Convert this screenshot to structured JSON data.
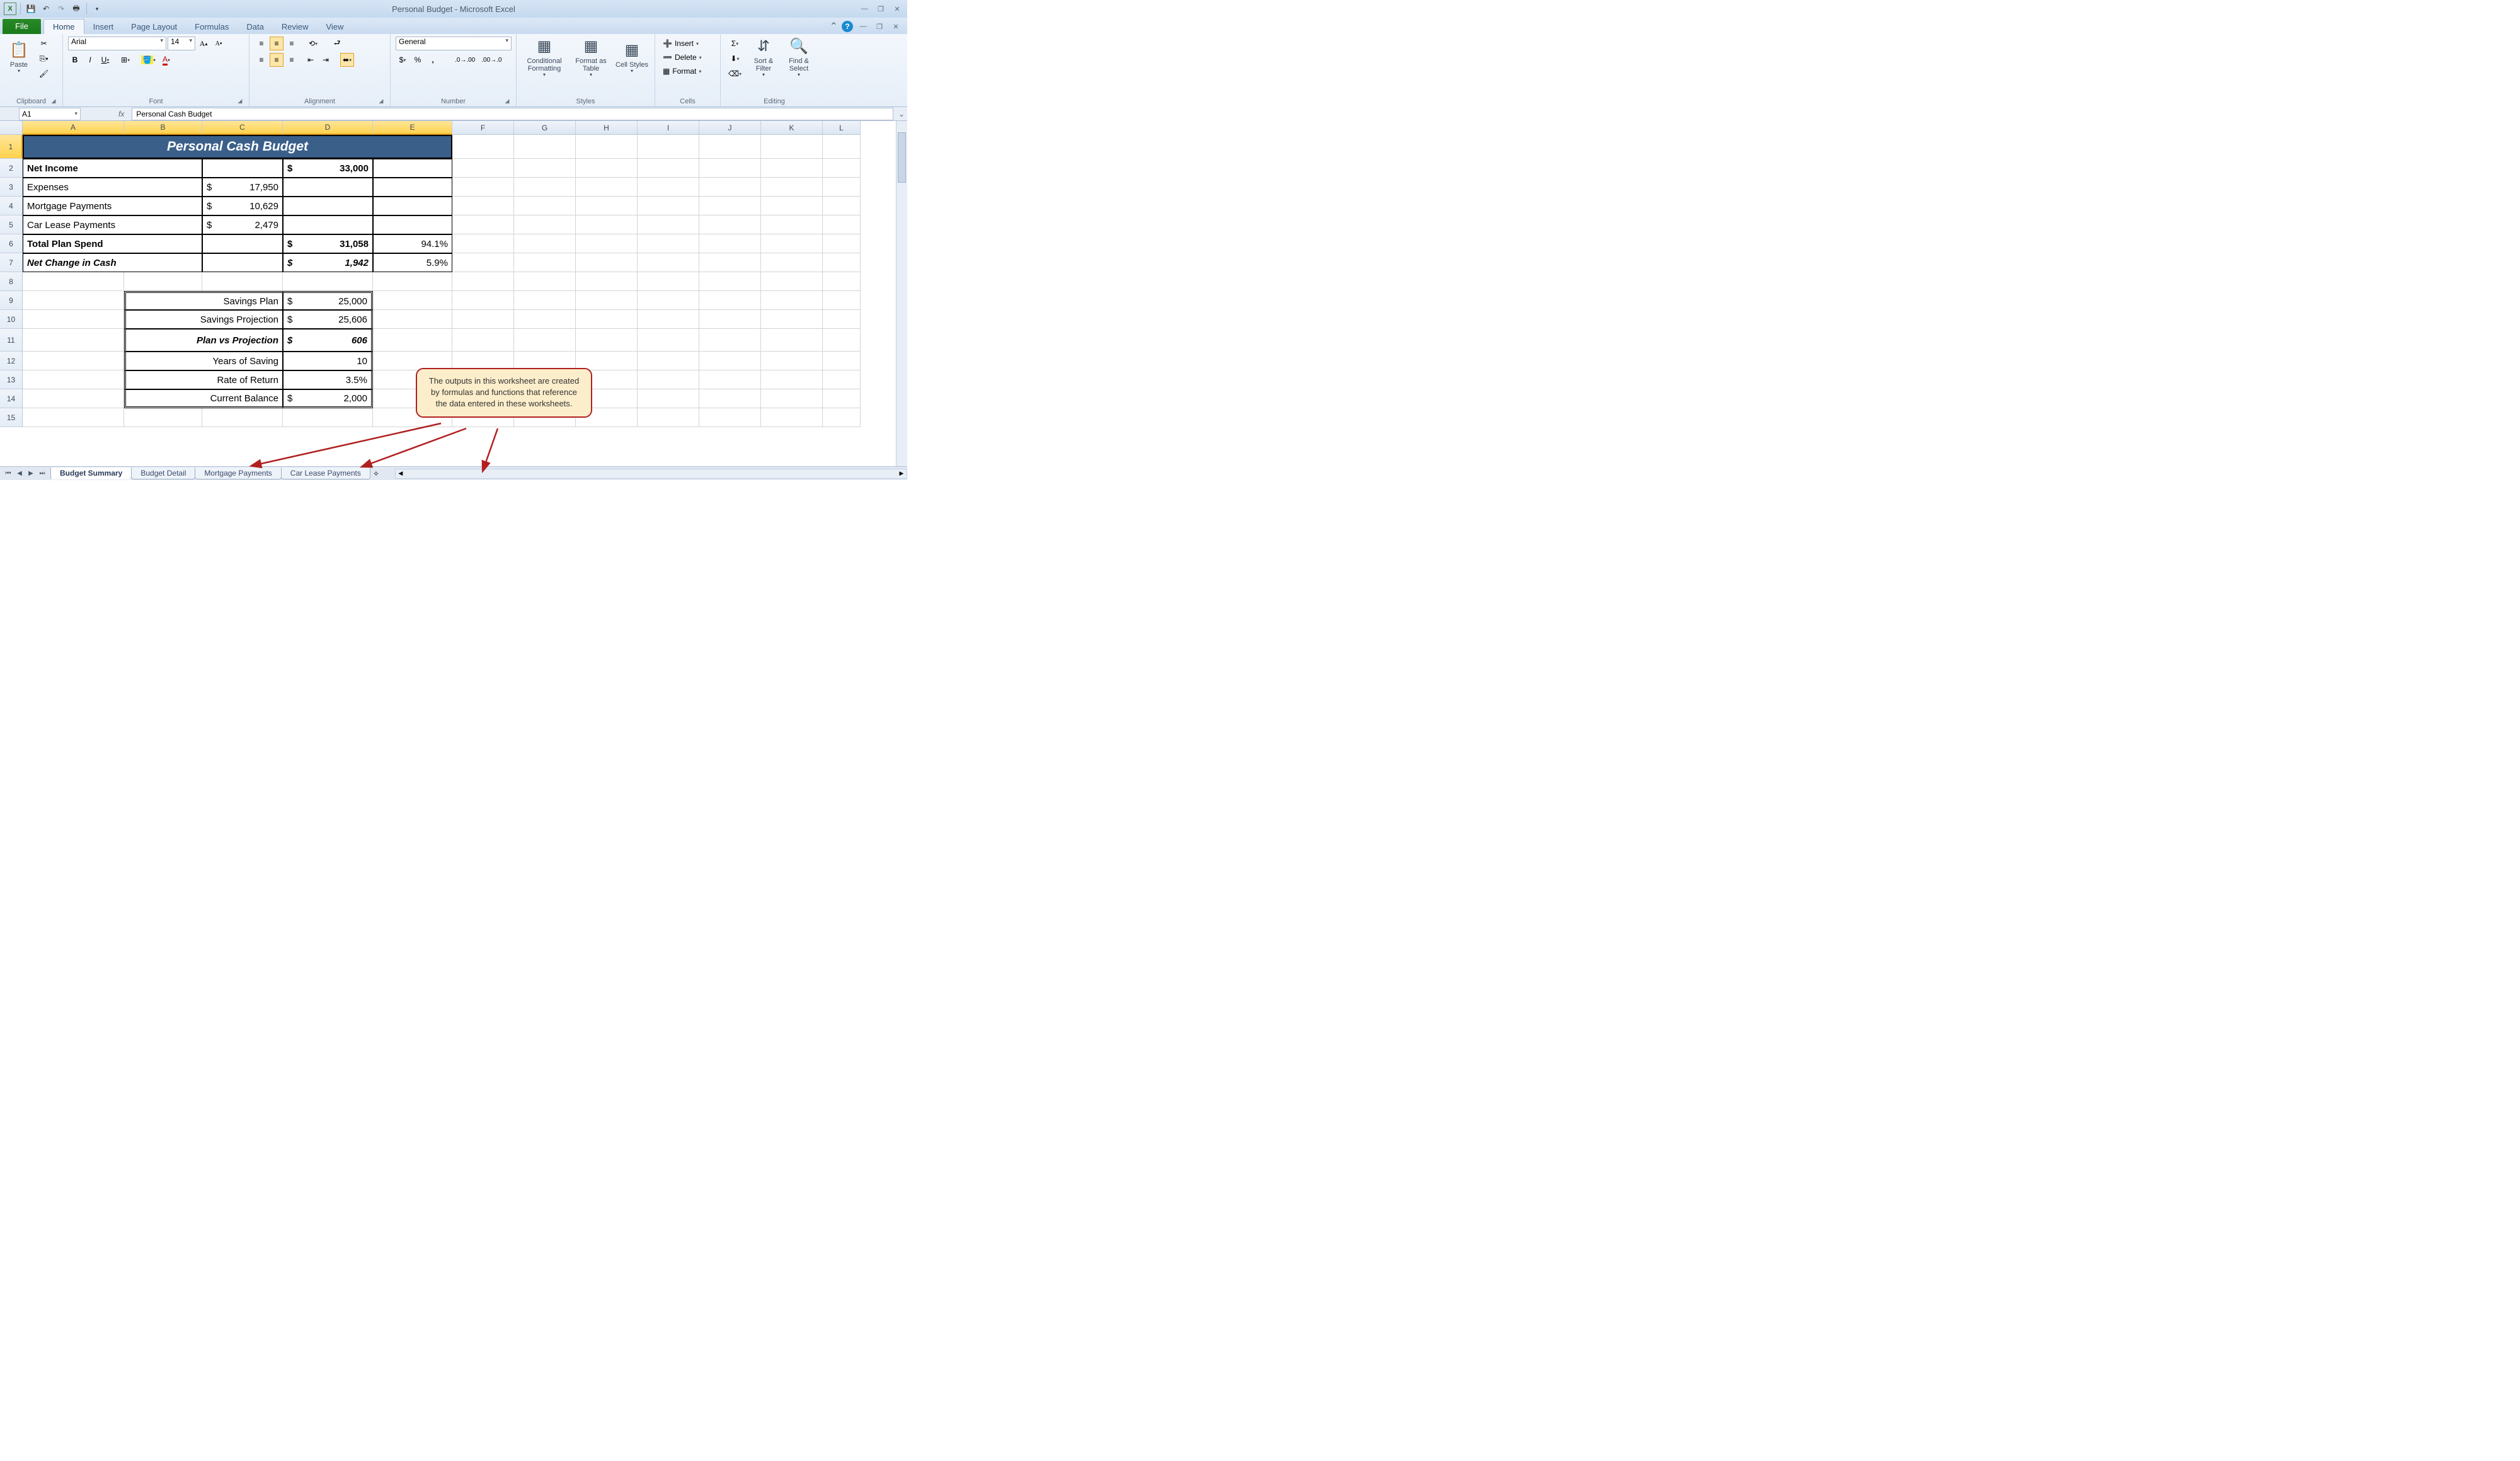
{
  "app": {
    "title": "Personal Budget - Microsoft Excel"
  },
  "tabs": {
    "file": "File",
    "home": "Home",
    "insert": "Insert",
    "page_layout": "Page Layout",
    "formulas": "Formulas",
    "data": "Data",
    "review": "Review",
    "view": "View"
  },
  "ribbon": {
    "clipboard": {
      "label": "Clipboard",
      "paste": "Paste"
    },
    "font": {
      "label": "Font",
      "name": "Arial",
      "size": "14",
      "bold": "B",
      "italic": "I",
      "underline": "U"
    },
    "alignment": {
      "label": "Alignment"
    },
    "number": {
      "label": "Number",
      "format": "General"
    },
    "styles": {
      "label": "Styles",
      "cond": "Conditional Formatting",
      "fmt_table": "Format as Table",
      "cell_styles": "Cell Styles"
    },
    "cells": {
      "label": "Cells",
      "insert": "Insert",
      "delete": "Delete",
      "format": "Format"
    },
    "editing": {
      "label": "Editing",
      "sort": "Sort & Filter",
      "find": "Find & Select"
    }
  },
  "namebox": "A1",
  "formula": "Personal Cash Budget",
  "cols": [
    "A",
    "B",
    "C",
    "D",
    "E",
    "F",
    "G",
    "H",
    "I",
    "J",
    "K",
    "L"
  ],
  "rows": [
    "1",
    "2",
    "3",
    "4",
    "5",
    "6",
    "7",
    "8",
    "9",
    "10",
    "11",
    "12",
    "13",
    "14",
    "15"
  ],
  "sheet": {
    "title": "Personal Cash Budget",
    "r2a": "Net Income",
    "r2d": "33,000",
    "r3a": "Expenses",
    "r3c": "17,950",
    "r4a": "Mortgage Payments",
    "r4c": "10,629",
    "r5a": "Car Lease Payments",
    "r5c": "2,479",
    "r6a": "Total Plan Spend",
    "r6d": "31,058",
    "r6e": "94.1%",
    "r7a": "Net Change in Cash",
    "r7d": "1,942",
    "r7e": "5.9%",
    "r9bc": "Savings Plan",
    "r9d": "25,000",
    "r10bc": "Savings Projection",
    "r10d": "25,606",
    "r11bc": "Plan vs Projection",
    "r11d": "606",
    "r12bc": "Years of Saving",
    "r12d": "10",
    "r13bc": "Rate of Return",
    "r13d": "3.5%",
    "r14bc": "Current Balance",
    "r14d": "2,000",
    "dollar": "$"
  },
  "callout": "The outputs in this worksheet are created by formulas and functions that reference the data entered in these worksheets.",
  "sheets": {
    "s1": "Budget Summary",
    "s2": "Budget Detail",
    "s3": "Mortgage Payments",
    "s4": "Car Lease Payments"
  }
}
